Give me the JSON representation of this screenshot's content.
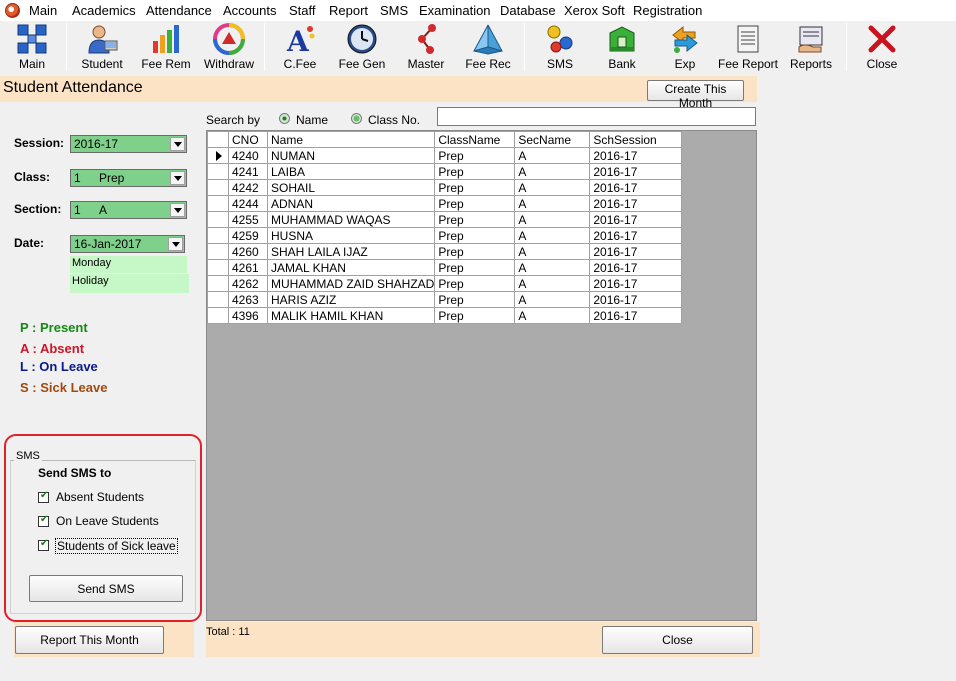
{
  "menu": [
    "Main",
    "Academics",
    "Attendance",
    "Accounts",
    "Staff",
    "Report",
    "SMS",
    "Examination",
    "Database",
    "Xerox Soft",
    "Registration"
  ],
  "toolbar": {
    "main": "Main",
    "student": "Student",
    "fee_rem": "Fee Rem",
    "withdraw": "Withdraw",
    "cfee": "C.Fee",
    "fee_gen": "Fee Gen",
    "master": "Master",
    "fee_rec": "Fee Rec",
    "sms": "SMS",
    "bank": "Bank",
    "exp": "Exp",
    "fee_report": "Fee Report",
    "reports": "Reports",
    "close": "Close"
  },
  "form": {
    "title": "Student Attendance",
    "create_month_button": "Create This Month",
    "session_label": "Session:",
    "session_value": "2016-17",
    "class_label": "Class:",
    "class_num": "1",
    "class_name": "Prep",
    "section_label": "Section:",
    "section_num": "1",
    "section_name": "A",
    "date_label": "Date:",
    "date_value": "16-Jan-2017",
    "day_name": "Monday",
    "day_status": "Holiday"
  },
  "legend": {
    "present": "P : Present",
    "absent": "A : Absent",
    "leave": "L : On Leave",
    "sick": "S : Sick Leave"
  },
  "sms": {
    "group_label": "SMS",
    "heading": "Send SMS to",
    "absent": "Absent Students",
    "on_leave": "On Leave Students",
    "sick": "Students of Sick  leave",
    "send_button": "Send SMS"
  },
  "search": {
    "label": "Search by",
    "opt_name": "Name",
    "opt_class": "Class No.",
    "value": ""
  },
  "grid": {
    "columns": [
      "CNO",
      "Name",
      "ClassName",
      "SecName",
      "SchSession"
    ],
    "rows": [
      [
        "4240",
        "NUMAN",
        "Prep",
        "A",
        "2016-17"
      ],
      [
        "4241",
        "LAIBA",
        "Prep",
        "A",
        "2016-17"
      ],
      [
        "4242",
        "SOHAIL",
        "Prep",
        "A",
        "2016-17"
      ],
      [
        "4244",
        "ADNAN",
        "Prep",
        "A",
        "2016-17"
      ],
      [
        "4255",
        "MUHAMMAD WAQAS",
        "Prep",
        "A",
        "2016-17"
      ],
      [
        "4259",
        "HUSNA",
        "Prep",
        "A",
        "2016-17"
      ],
      [
        "4260",
        "SHAH LAILA IJAZ",
        "Prep",
        "A",
        "2016-17"
      ],
      [
        "4261",
        "JAMAL KHAN",
        "Prep",
        "A",
        "2016-17"
      ],
      [
        "4262",
        "MUHAMMAD ZAID SHAHZAD",
        "Prep",
        "A",
        "2016-17"
      ],
      [
        "4263",
        "HARIS AZIZ",
        "Prep",
        "A",
        "2016-17"
      ],
      [
        "4396",
        "MALIK HAMIL KHAN",
        "Prep",
        "A",
        "2016-17"
      ]
    ]
  },
  "footer": {
    "report_button": "Report This Month",
    "total": "Total : 11",
    "close_button": "Close"
  },
  "colors": {
    "present": "#138a13",
    "absent": "#d0142a",
    "leave": "#0a1a8a",
    "sick": "#a04a10",
    "highlight": "#e0202a"
  }
}
